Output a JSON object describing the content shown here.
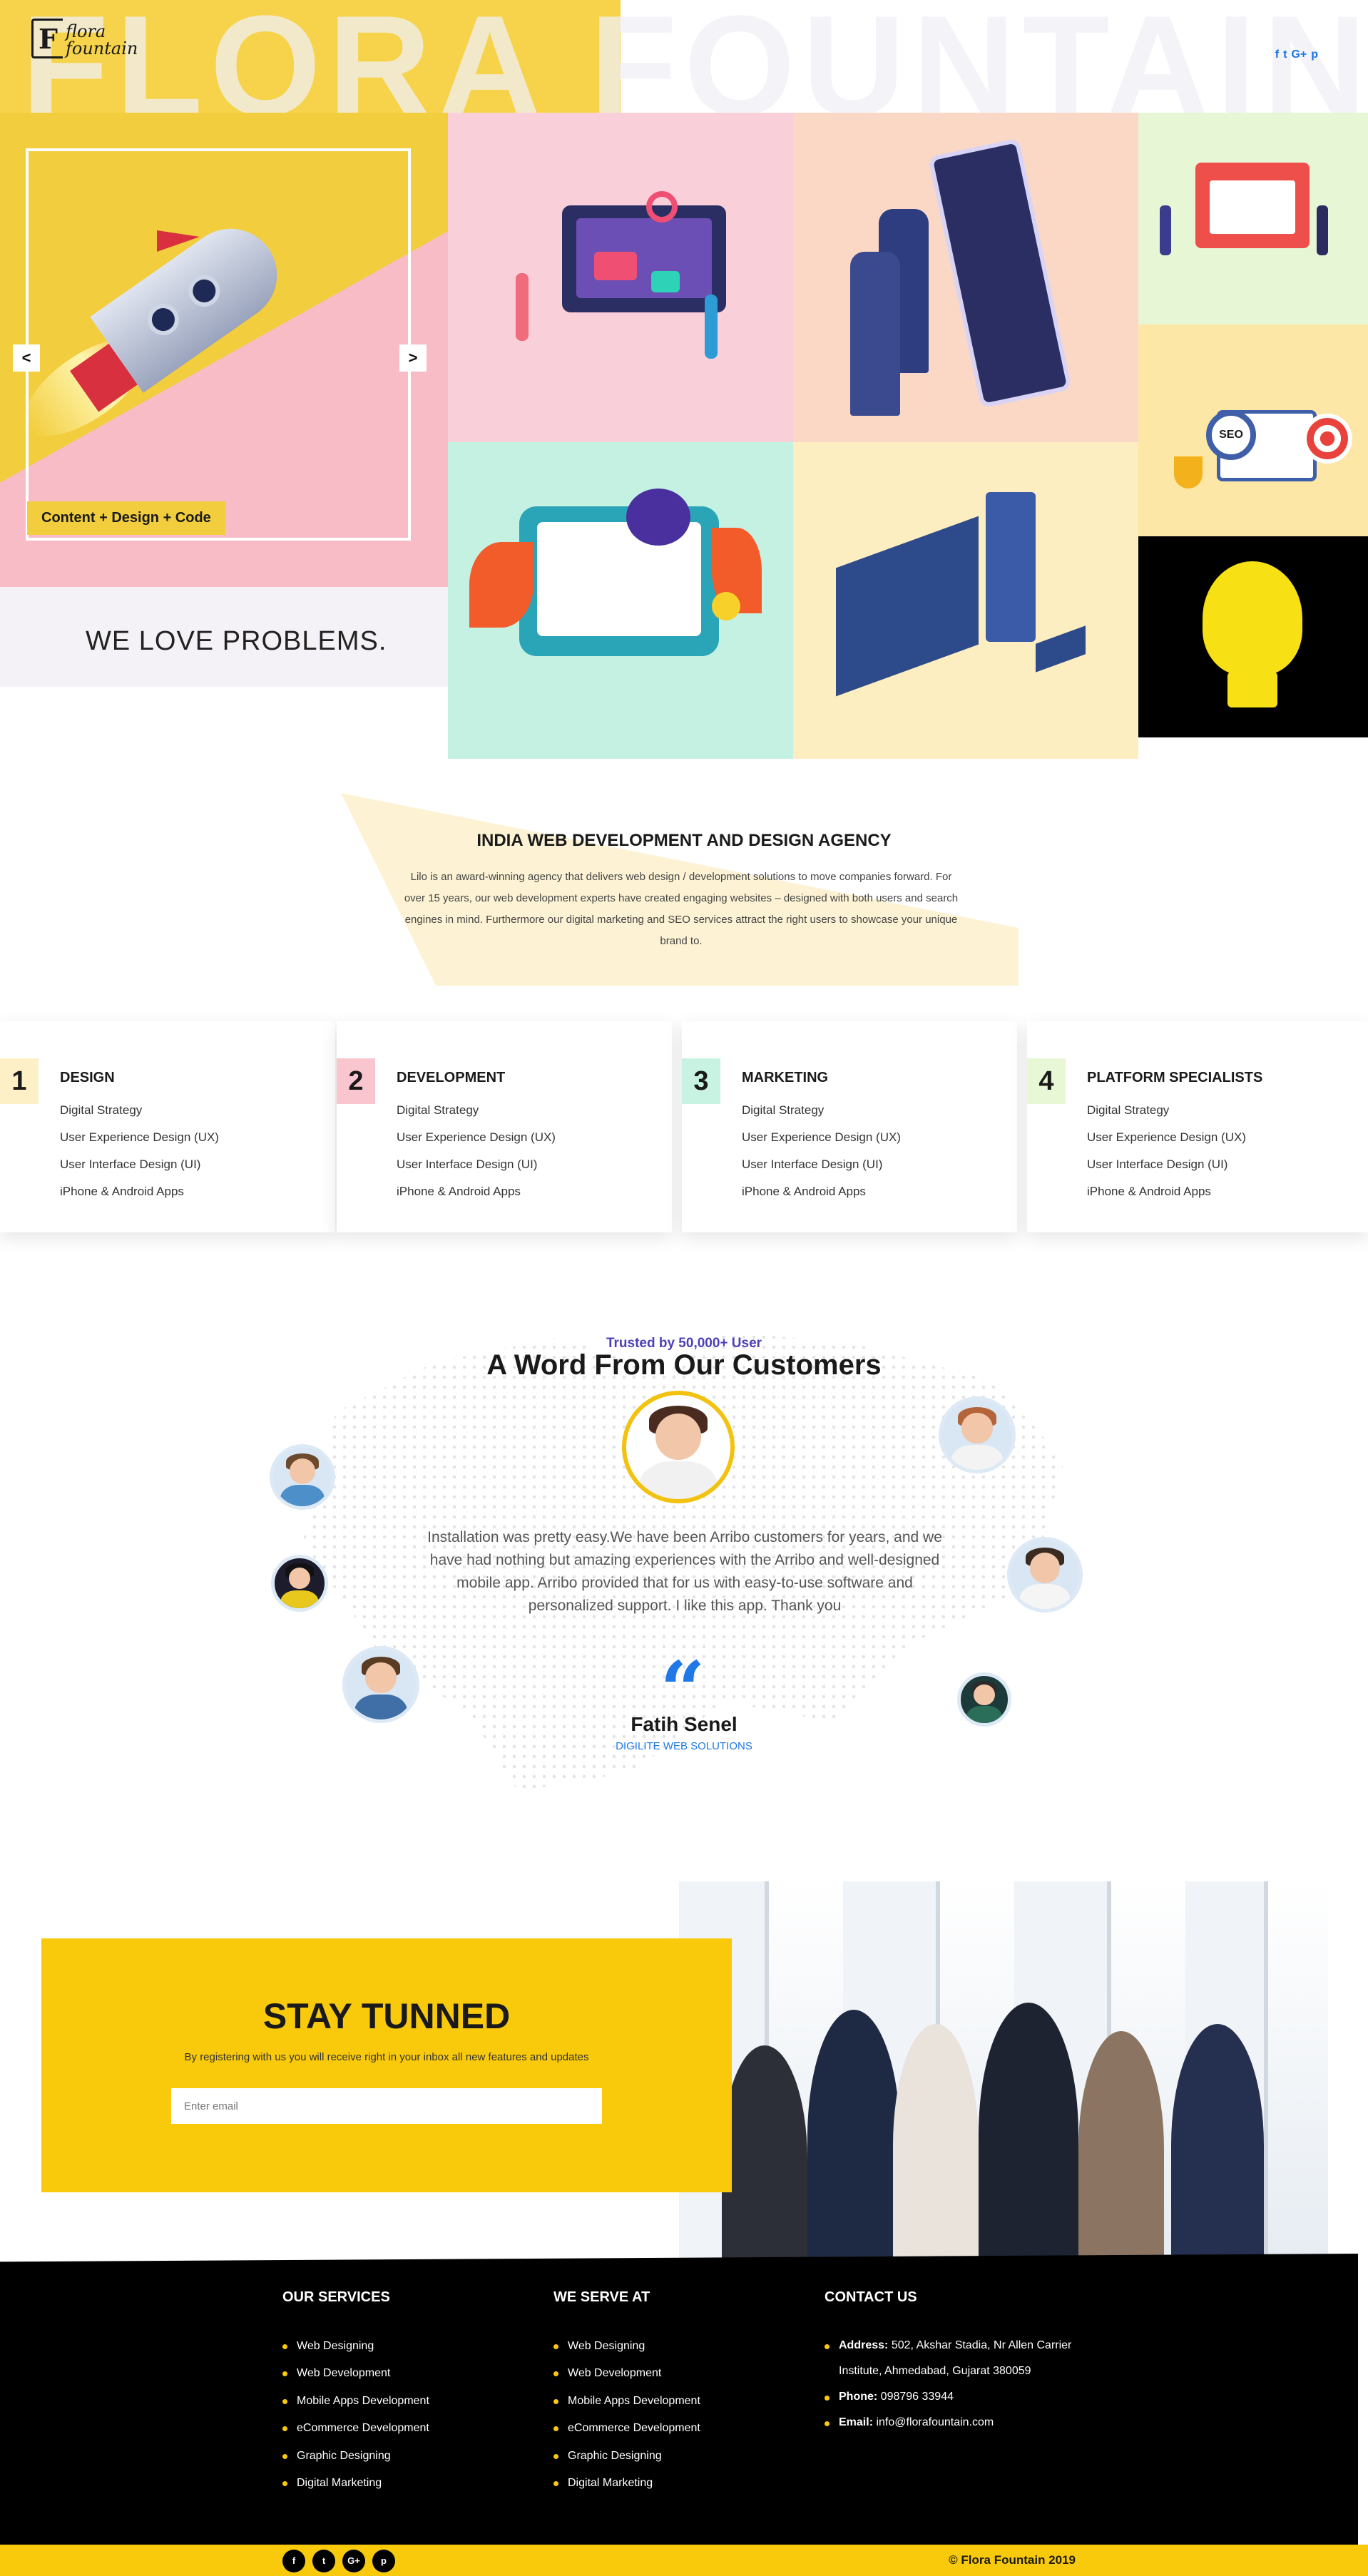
{
  "header": {
    "background_word": "FLORA FOUNTAIN",
    "logo_mark": "F",
    "logo_text_line1": "flora",
    "logo_text_line2": "fountain",
    "social": [
      "f",
      "t",
      "G+",
      "p"
    ]
  },
  "hero": {
    "badge": "Content + Design + Code",
    "tagline": "WE LOVE PROBLEMS.",
    "prev_arrow": "<",
    "next_arrow": ">"
  },
  "agency": {
    "title": "INDIA WEB DEVELOPMENT AND DESIGN AGENCY",
    "text": "Lilo is an award-winning agency that delivers web design / development solutions to move companies forward. For over 15 years, our web development experts have created engaging websites – designed with both users and search engines in mind. Furthermore our digital marketing and SEO services attract the right users to showcase your unique brand to."
  },
  "services": [
    {
      "num": "1",
      "title": "DESIGN",
      "items": [
        "Digital Strategy",
        "User Experience Design (UX)",
        "User Interface Design (UI)",
        "iPhone & Android Apps"
      ],
      "color": "#fdf0c7"
    },
    {
      "num": "2",
      "title": "DEVELOPMENT",
      "items": [
        "Digital Strategy",
        "User Experience Design (UX)",
        "User Interface Design (UI)",
        "iPhone & Android Apps"
      ],
      "color": "#f9c5cf"
    },
    {
      "num": "3",
      "title": "MARKETING",
      "items": [
        "Digital Strategy",
        "User Experience Design (UX)",
        "User Interface Design (UI)",
        "iPhone & Android Apps"
      ],
      "color": "#c8f3e3"
    },
    {
      "num": "4",
      "title": "PLATFORM SPECIALISTS",
      "items": [
        "Digital Strategy",
        "User Experience Design (UX)",
        "User Interface Design (UI)",
        "iPhone & Android Apps"
      ],
      "color": "#e8f7d6"
    }
  ],
  "testimonials": {
    "trusted": "Trusted by 50,000+ User",
    "title": "A Word From Our Customers",
    "quote": "Installation was pretty easy.We have been Arribo customers for years, and we have had nothing but amazing experiences with the Arribo and well-designed mobile app. Arribo provided that for us with easy-to-use software and personalized support. I like this app. Thank you",
    "quote_mark": "“",
    "name": "Fatih Senel",
    "company": "DIGILITE WEB SOLUTIONS"
  },
  "subscribe": {
    "title": "STAY TUNNED",
    "text": "By registering with us you will receive right in your inbox all new features and updates",
    "placeholder": "Enter email"
  },
  "footer": {
    "services_title": "OUR SERVICES",
    "services": [
      "Web Designing",
      "Web Development",
      "Mobile Apps Development",
      "eCommerce Development",
      "Graphic Designing",
      "Digital Marketing"
    ],
    "serve_title": "WE SERVE AT",
    "serve": [
      "Web Designing",
      "Web Development",
      "Mobile Apps Development",
      "eCommerce Development",
      "Graphic Designing",
      "Digital Marketing"
    ],
    "contact_title": "CONTACT US",
    "address_label": "Address:",
    "address_value": "502, Akshar Stadia, Nr Allen Carrier Institute, Ahmedabad, Gujarat 380059",
    "phone_label": "Phone:",
    "phone_value": "098796 33944",
    "email_label": "Email:",
    "email_value": "info@florafountain.com",
    "social": [
      "f",
      "t",
      "G+",
      "p"
    ],
    "copyright": "© Flora Fountain 2019"
  },
  "colors": {
    "accent_yellow": "#f9c90c",
    "link_blue": "#1f78e6",
    "trusted_purple": "#4d3fb7"
  }
}
